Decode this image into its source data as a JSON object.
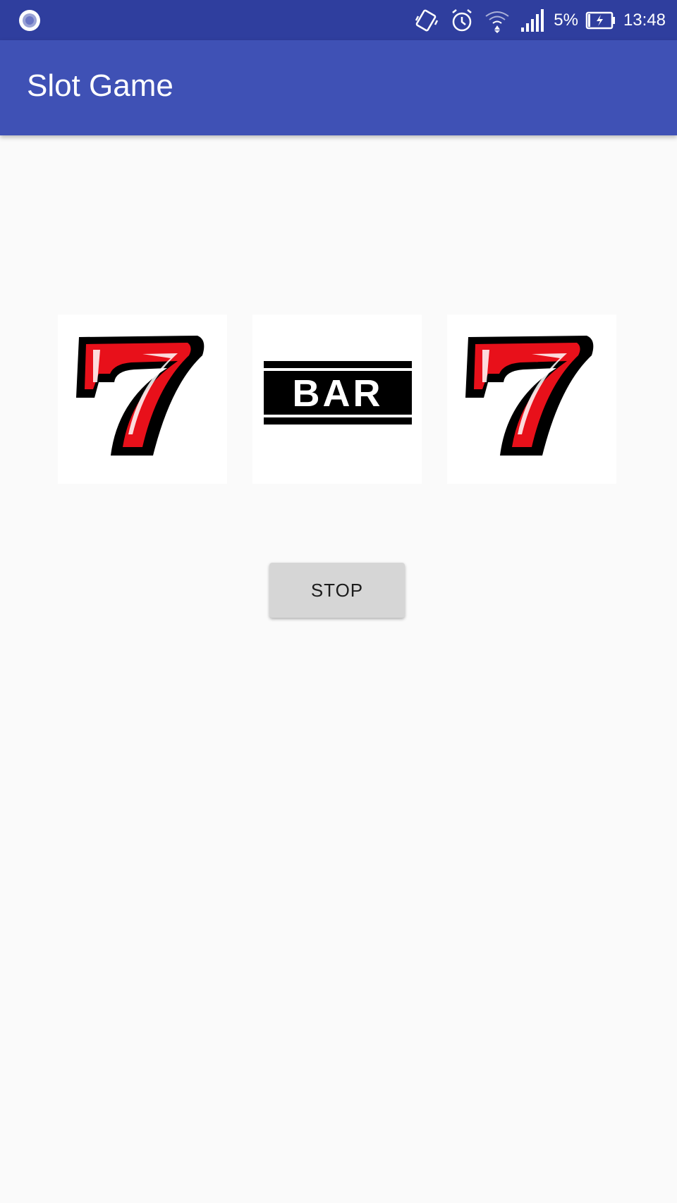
{
  "status_bar": {
    "battery_percent": "5%",
    "time": "13:48",
    "icons": [
      "assistant-dot-icon",
      "vibrate-icon",
      "alarm-icon",
      "wifi-icon",
      "signal-icon",
      "battery-charging-icon"
    ]
  },
  "app_bar": {
    "title": "Slot Game"
  },
  "reels": [
    {
      "symbol": "seven"
    },
    {
      "symbol": "bar",
      "label": "BAR"
    },
    {
      "symbol": "seven"
    }
  ],
  "controls": {
    "stop_label": "STOP"
  },
  "colors": {
    "status_bar": "#2f3e9e",
    "app_bar": "#3f51b5",
    "background": "#fafafa",
    "seven_red": "#e8101a",
    "button": "#d6d6d6"
  }
}
